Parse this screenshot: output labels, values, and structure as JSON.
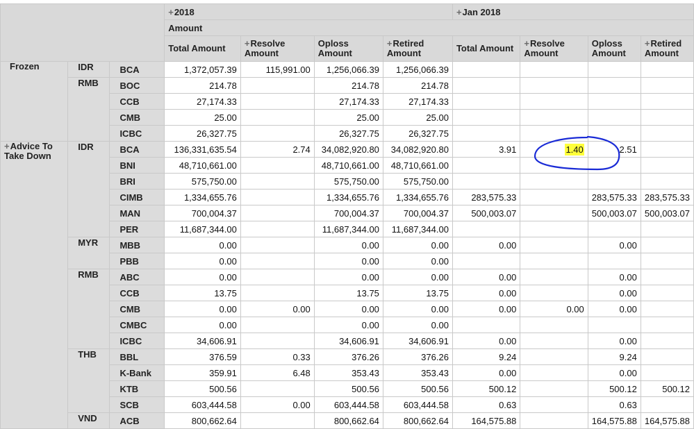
{
  "header": {
    "period_2018": "2018",
    "period_jan2018": "Jan 2018",
    "measure_group": "Amount",
    "columns": [
      "Total Amount",
      "Resolve Amount",
      "Oploss Amount",
      "Retired Amount",
      "Total Amount",
      "Resolve Amount",
      "Oploss Amount",
      "Retired Amount"
    ]
  },
  "groups": [
    {
      "label": "Frozen",
      "expandable": false,
      "currencies": [
        {
          "code": "IDR",
          "rows": [
            {
              "bank": "BCA",
              "values": [
                "1,372,057.39",
                "115,991.00",
                "1,256,066.39",
                "1,256,066.39",
                "",
                "",
                "",
                ""
              ]
            }
          ]
        },
        {
          "code": "RMB",
          "rows": [
            {
              "bank": "BOC",
              "values": [
                "214.78",
                "",
                "214.78",
                "214.78",
                "",
                "",
                "",
                ""
              ]
            },
            {
              "bank": "CCB",
              "values": [
                "27,174.33",
                "",
                "27,174.33",
                "27,174.33",
                "",
                "",
                "",
                ""
              ]
            },
            {
              "bank": "CMB",
              "values": [
                "25.00",
                "",
                "25.00",
                "25.00",
                "",
                "",
                "",
                ""
              ]
            },
            {
              "bank": "ICBC",
              "values": [
                "26,327.75",
                "",
                "26,327.75",
                "26,327.75",
                "",
                "",
                "",
                ""
              ]
            }
          ]
        }
      ]
    },
    {
      "label": "Advice To Take Down",
      "expandable": true,
      "currencies": [
        {
          "code": "IDR",
          "rows": [
            {
              "bank": "BCA",
              "values": [
                "136,331,635.54",
                "2.74",
                "34,082,920.80",
                "34,082,920.80",
                "3.91",
                "1.40",
                "2.51",
                ""
              ]
            },
            {
              "bank": "BNI",
              "values": [
                "48,710,661.00",
                "",
                "48,710,661.00",
                "48,710,661.00",
                "",
                "",
                "",
                ""
              ]
            },
            {
              "bank": "BRI",
              "values": [
                "575,750.00",
                "",
                "575,750.00",
                "575,750.00",
                "",
                "",
                "",
                ""
              ]
            },
            {
              "bank": "CIMB",
              "values": [
                "1,334,655.76",
                "",
                "1,334,655.76",
                "1,334,655.76",
                "283,575.33",
                "",
                "283,575.33",
                "283,575.33"
              ]
            },
            {
              "bank": "MAN",
              "values": [
                "700,004.37",
                "",
                "700,004.37",
                "700,004.37",
                "500,003.07",
                "",
                "500,003.07",
                "500,003.07"
              ]
            },
            {
              "bank": "PER",
              "values": [
                "11,687,344.00",
                "",
                "11,687,344.00",
                "11,687,344.00",
                "",
                "",
                "",
                ""
              ]
            }
          ]
        },
        {
          "code": "MYR",
          "rows": [
            {
              "bank": "MBB",
              "values": [
                "0.00",
                "",
                "0.00",
                "0.00",
                "0.00",
                "",
                "0.00",
                ""
              ]
            },
            {
              "bank": "PBB",
              "values": [
                "0.00",
                "",
                "0.00",
                "0.00",
                "",
                "",
                "",
                ""
              ]
            }
          ]
        },
        {
          "code": "RMB",
          "rows": [
            {
              "bank": "ABC",
              "values": [
                "0.00",
                "",
                "0.00",
                "0.00",
                "0.00",
                "",
                "0.00",
                ""
              ]
            },
            {
              "bank": "CCB",
              "values": [
                "13.75",
                "",
                "13.75",
                "13.75",
                "0.00",
                "",
                "0.00",
                ""
              ]
            },
            {
              "bank": "CMB",
              "values": [
                "0.00",
                "0.00",
                "0.00",
                "0.00",
                "0.00",
                "0.00",
                "0.00",
                ""
              ]
            },
            {
              "bank": "CMBC",
              "values": [
                "0.00",
                "",
                "0.00",
                "0.00",
                "",
                "",
                "",
                ""
              ]
            },
            {
              "bank": "ICBC",
              "values": [
                "34,606.91",
                "",
                "34,606.91",
                "34,606.91",
                "0.00",
                "",
                "0.00",
                ""
              ]
            }
          ]
        },
        {
          "code": "THB",
          "rows": [
            {
              "bank": "BBL",
              "values": [
                "376.59",
                "0.33",
                "376.26",
                "376.26",
                "9.24",
                "",
                "9.24",
                ""
              ]
            },
            {
              "bank": "K-Bank",
              "values": [
                "359.91",
                "6.48",
                "353.43",
                "353.43",
                "0.00",
                "",
                "0.00",
                ""
              ]
            },
            {
              "bank": "KTB",
              "values": [
                "500.56",
                "",
                "500.56",
                "500.56",
                "500.12",
                "",
                "500.12",
                "500.12"
              ]
            },
            {
              "bank": "SCB",
              "values": [
                "603,444.58",
                "0.00",
                "603,444.58",
                "603,444.58",
                "0.63",
                "",
                "0.63",
                ""
              ]
            }
          ]
        },
        {
          "code": "VND",
          "rows": [
            {
              "bank": "ACB",
              "values": [
                "800,662.64",
                "",
                "800,662.64",
                "800,662.64",
                "164,575.88",
                "",
                "164,575.88",
                "164,575.88"
              ]
            }
          ]
        }
      ]
    }
  ],
  "highlight": {
    "value": "1.40",
    "color": "#ffff3a"
  },
  "annotation": {
    "color": "#1a2bd6"
  }
}
